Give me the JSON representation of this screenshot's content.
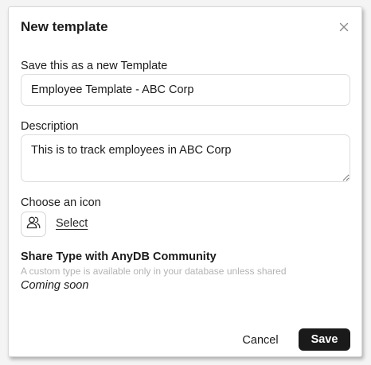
{
  "dialog": {
    "title": "New template",
    "close_icon": "close-icon"
  },
  "template_name": {
    "label": "Save this as a new Template",
    "value": "Employee Template - ABC Corp"
  },
  "description": {
    "label": "Description",
    "value": "This is to track employees in ABC Corp"
  },
  "icon_picker": {
    "label": "Choose an icon",
    "current_icon": "users-icon",
    "select_label": "Select"
  },
  "share": {
    "title": "Share Type with AnyDB Community",
    "subtitle": "A custom type is available only in your database unless shared",
    "status": "Coming soon"
  },
  "actions": {
    "cancel_label": "Cancel",
    "save_label": "Save",
    "save_bg": "#1a1a1a"
  }
}
